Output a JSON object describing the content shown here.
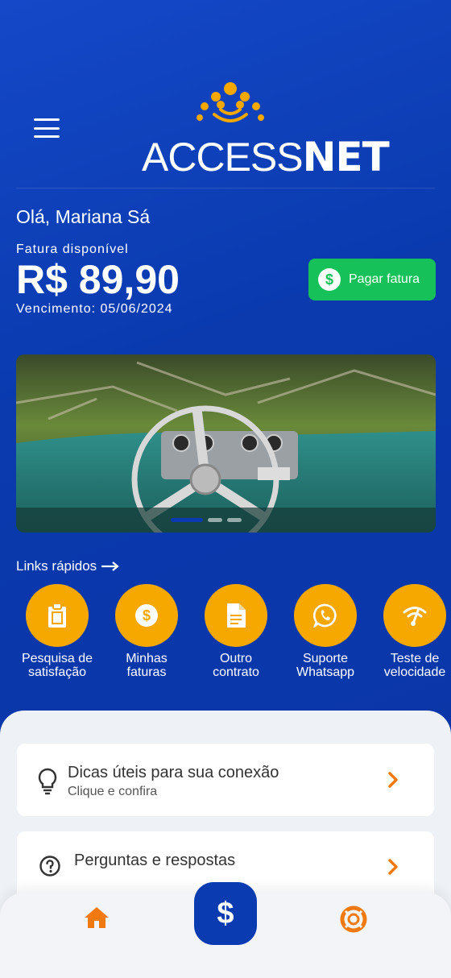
{
  "header": {
    "logo_text_light": "ACCESS",
    "logo_text_bold": "NET"
  },
  "account": {
    "greeting": "Olá, Mariana Sá",
    "invoice_label": "Fatura disponível",
    "invoice_amount": "R$ 89,90",
    "due_date": "Vencimento: 05/06/2024",
    "pay_button_label": "Pagar fatura"
  },
  "carousel": {
    "slide_count": 3,
    "active_index": 0
  },
  "quick_links": {
    "title": "Links rápidos",
    "items": [
      {
        "label": "Pesquisa de\nsatisfação",
        "icon": "clipboard-icon"
      },
      {
        "label": "Minhas\nfaturas",
        "icon": "dollar-icon"
      },
      {
        "label": "Outro\ncontrato",
        "icon": "document-icon"
      },
      {
        "label": "Suporte\nWhatsapp",
        "icon": "whatsapp-icon"
      },
      {
        "label": "Teste de\nvelocidade",
        "icon": "wifi-speed-icon"
      }
    ]
  },
  "cards": [
    {
      "title": "Dicas úteis para sua conexão",
      "subtitle": "Clique e confira",
      "icon": "lightbulb-icon"
    },
    {
      "title": "Perguntas e respostas",
      "subtitle": "",
      "icon": "question-icon"
    }
  ],
  "bottom_nav": {
    "home_icon": "home-icon",
    "pay_symbol": "$",
    "support_icon": "lifebuoy-icon"
  },
  "colors": {
    "brand_blue": "#0a3bb0",
    "accent_orange": "#f6a800",
    "pay_green": "#16c15a",
    "nav_orange": "#f07a10"
  }
}
